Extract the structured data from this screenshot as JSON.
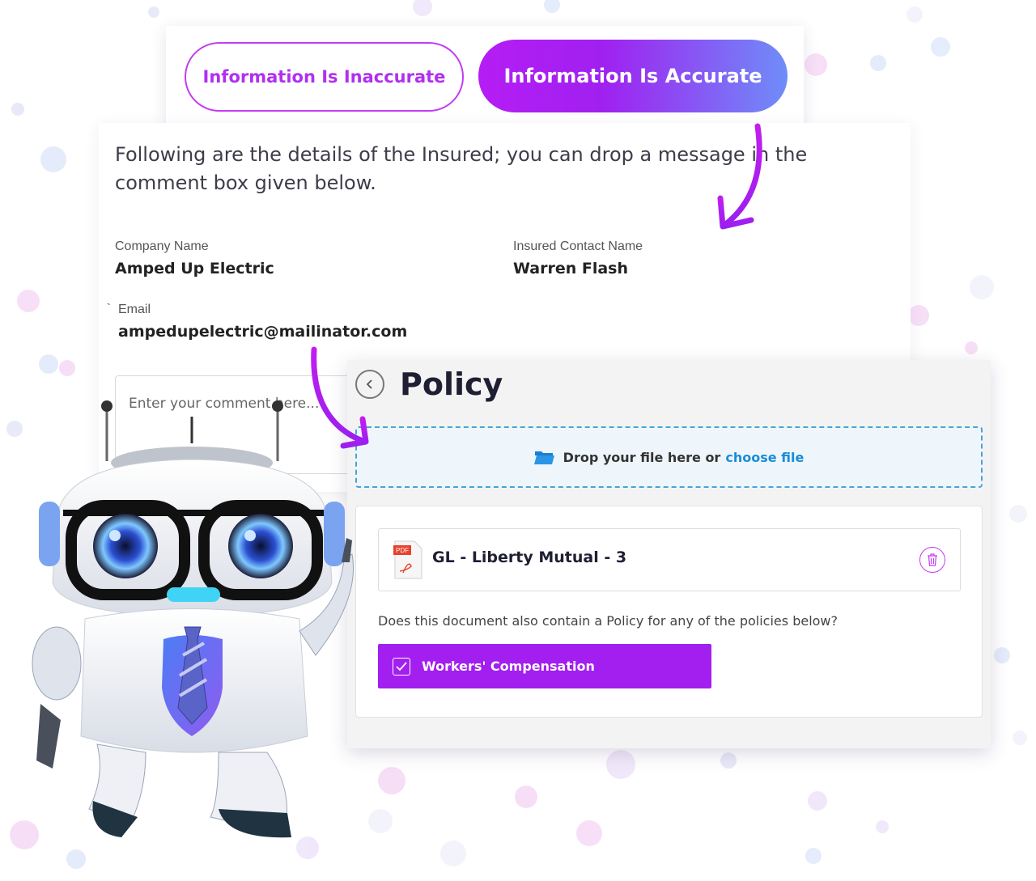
{
  "theme": {
    "accent": "#a21ff0",
    "accent_gradient_end": "#6f8df8",
    "link": "#1a8cd8"
  },
  "actions": {
    "inaccurate_label": "Information Is Inaccurate",
    "accurate_label": "Information Is Accurate"
  },
  "details": {
    "intro": "Following are the details of the Insured; you can drop a message in the comment box given below.",
    "company_name_label": "Company Name",
    "company_name_value": "Amped Up Electric",
    "contact_name_label": "Insured Contact Name",
    "contact_name_value": "Warren Flash",
    "email_label": "Email",
    "email_value": "ampedupelectric@mailinator.com",
    "stray_mark": "`",
    "comment_placeholder": "Enter your comment here..."
  },
  "policy": {
    "title": "Policy",
    "drop_text": "Drop your file here or",
    "choose_file": "choose file",
    "file_name": "GL - Liberty Mutual - 3",
    "pdf_badge": "PDF",
    "question": "Does this document also contain a Policy for any of the policies below?",
    "option_label": "Workers' Compensation",
    "option_checked": true
  },
  "icons": [
    "folder-open-icon",
    "pdf-file-icon",
    "trash-icon",
    "back-chevron-icon",
    "checkbox-check-icon"
  ]
}
